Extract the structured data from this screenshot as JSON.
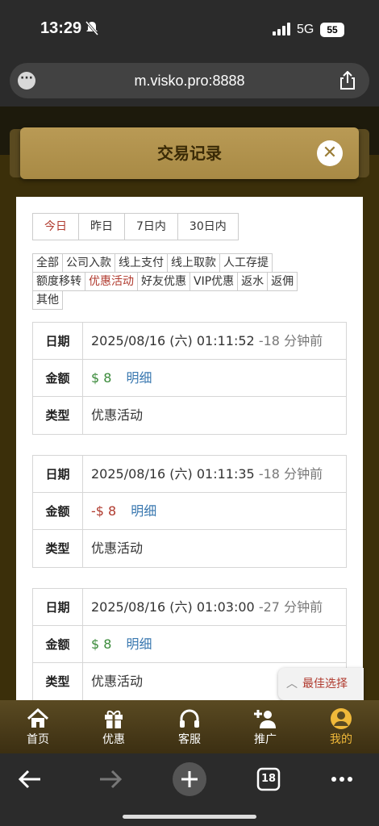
{
  "status_bar": {
    "time": "13:29",
    "network": "5G",
    "battery": "55"
  },
  "browser": {
    "url": "m.visko.pro:8888",
    "tabs_count": "18"
  },
  "modal": {
    "title": "交易记录"
  },
  "date_ranges": [
    {
      "label": "今日",
      "active": true
    },
    {
      "label": "昨日",
      "active": false
    },
    {
      "label": "7日内",
      "active": false
    },
    {
      "label": "30日内",
      "active": false
    }
  ],
  "types": [
    {
      "label": "全部",
      "active": false
    },
    {
      "label": "公司入款",
      "active": false
    },
    {
      "label": "线上支付",
      "active": false
    },
    {
      "label": "线上取款",
      "active": false
    },
    {
      "label": "人工存提",
      "active": false
    },
    {
      "label": "额度移转",
      "active": false
    },
    {
      "label": "优惠活动",
      "active": true
    },
    {
      "label": "好友优惠",
      "active": false
    },
    {
      "label": "VIP优惠",
      "active": false
    },
    {
      "label": "返水",
      "active": false
    },
    {
      "label": "返佣",
      "active": false
    },
    {
      "label": "其他",
      "active": false
    }
  ],
  "labels": {
    "date": "日期",
    "amount": "金额",
    "type": "类型",
    "detail": "明细"
  },
  "records": [
    {
      "date": "2025/08/16 (六) 01:11:52",
      "ago": "-18 分钟前",
      "amount": "$ 8",
      "sign": "positive",
      "type": "优惠活动"
    },
    {
      "date": "2025/08/16 (六) 01:11:35",
      "ago": "-18 分钟前",
      "amount": "-$ 8",
      "sign": "negative",
      "type": "优惠活动"
    },
    {
      "date": "2025/08/16 (六) 01:03:00",
      "ago": "-27 分钟前",
      "amount": "$ 8",
      "sign": "positive",
      "type": "优惠活动"
    }
  ],
  "best_choice": "最佳选择",
  "tabbar": [
    {
      "label": "首页",
      "icon": "home-icon",
      "active": false
    },
    {
      "label": "优惠",
      "icon": "gift-icon",
      "active": false
    },
    {
      "label": "客服",
      "icon": "headset-icon",
      "active": false
    },
    {
      "label": "推广",
      "icon": "add-user-icon",
      "active": false
    },
    {
      "label": "我的",
      "icon": "user-icon",
      "active": true
    }
  ],
  "colors": {
    "accent_red": "#b03a2e",
    "positive_green": "#3a8a3a",
    "link_blue": "#3a78b0",
    "gold": "#b99a55",
    "active_tab": "#f0b93a"
  }
}
